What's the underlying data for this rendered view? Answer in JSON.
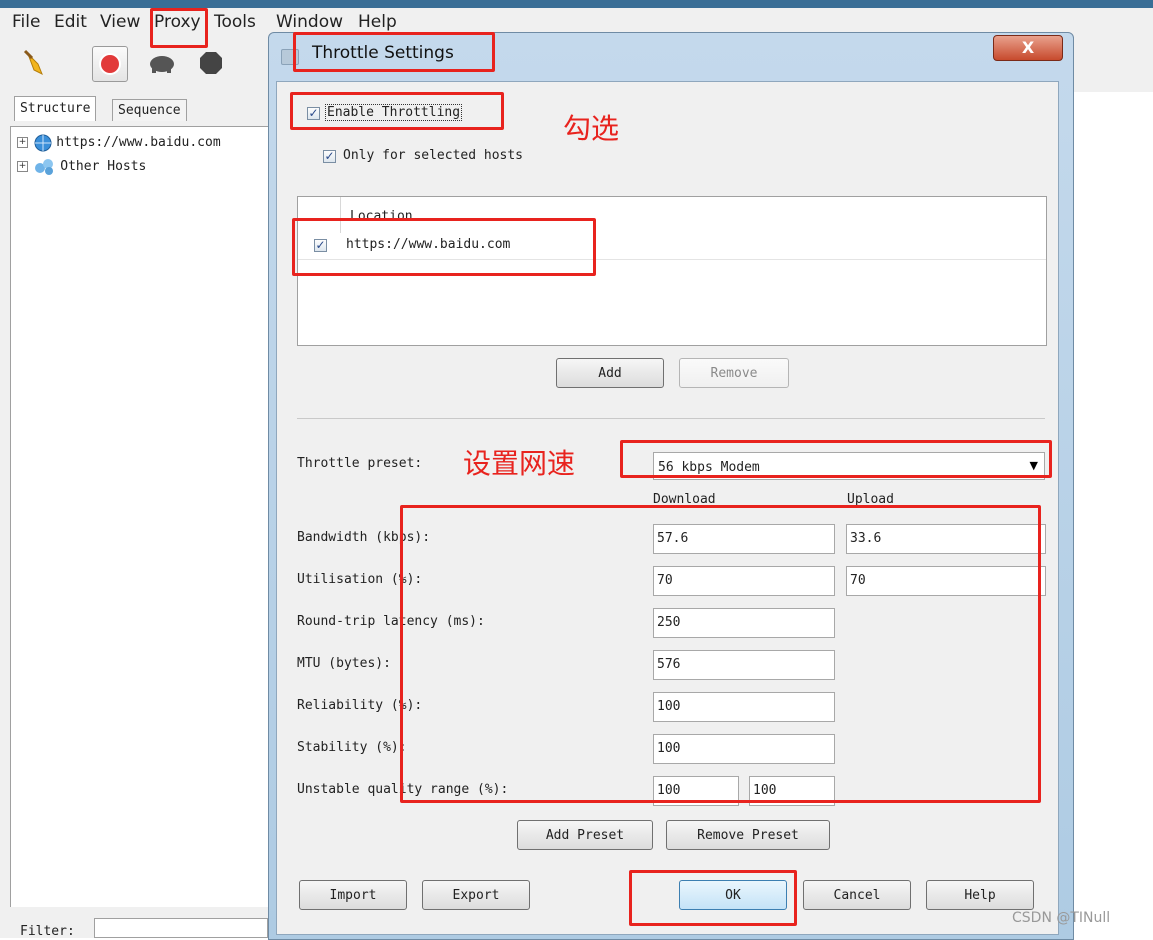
{
  "app": {
    "menu": [
      "File",
      "Edit",
      "View",
      "Proxy",
      "Tools",
      "Window",
      "Help"
    ],
    "tabs": [
      "Structure",
      "Sequence"
    ],
    "tree": [
      "https://www.baidu.com",
      "Other Hosts"
    ],
    "filter_label": "Filter:"
  },
  "dialog": {
    "title": "Throttle Settings",
    "close_glyph": "X",
    "enable_throttling_label": "Enable Throttling",
    "enable_throttling_checked": true,
    "only_selected_hosts_label": "Only for selected hosts",
    "only_selected_hosts_checked": true,
    "hosts_table": {
      "column_header": "Location",
      "rows": [
        {
          "checked": true,
          "location": "https://www.baidu.com"
        }
      ]
    },
    "add_label": "Add",
    "remove_label": "Remove",
    "preset_label": "Throttle preset:",
    "preset_value": "56 kbps Modem",
    "download_header": "Download",
    "upload_header": "Upload",
    "fields": {
      "bandwidth_label": "Bandwidth (kbps):",
      "bandwidth_download": "57.6",
      "bandwidth_upload": "33.6",
      "utilisation_label": "Utilisation (%):",
      "utilisation_download": "70",
      "utilisation_upload": "70",
      "latency_label": "Round-trip latency (ms):",
      "latency_value": "250",
      "mtu_label": "MTU (bytes):",
      "mtu_value": "576",
      "reliability_label": "Reliability (%):",
      "reliability_value": "100",
      "stability_label": "Stability (%):",
      "stability_value": "100",
      "unstable_label": "Unstable quality range (%):",
      "unstable_min": "100",
      "unstable_max": "100"
    },
    "add_preset_label": "Add Preset",
    "remove_preset_label": "Remove Preset",
    "import_label": "Import",
    "export_label": "Export",
    "ok_label": "OK",
    "cancel_label": "Cancel",
    "help_label": "Help"
  },
  "annotations": {
    "check_note": "勾选",
    "speed_note": "设置网速",
    "color": "#e8231e"
  },
  "watermark": "CSDN @TINull"
}
